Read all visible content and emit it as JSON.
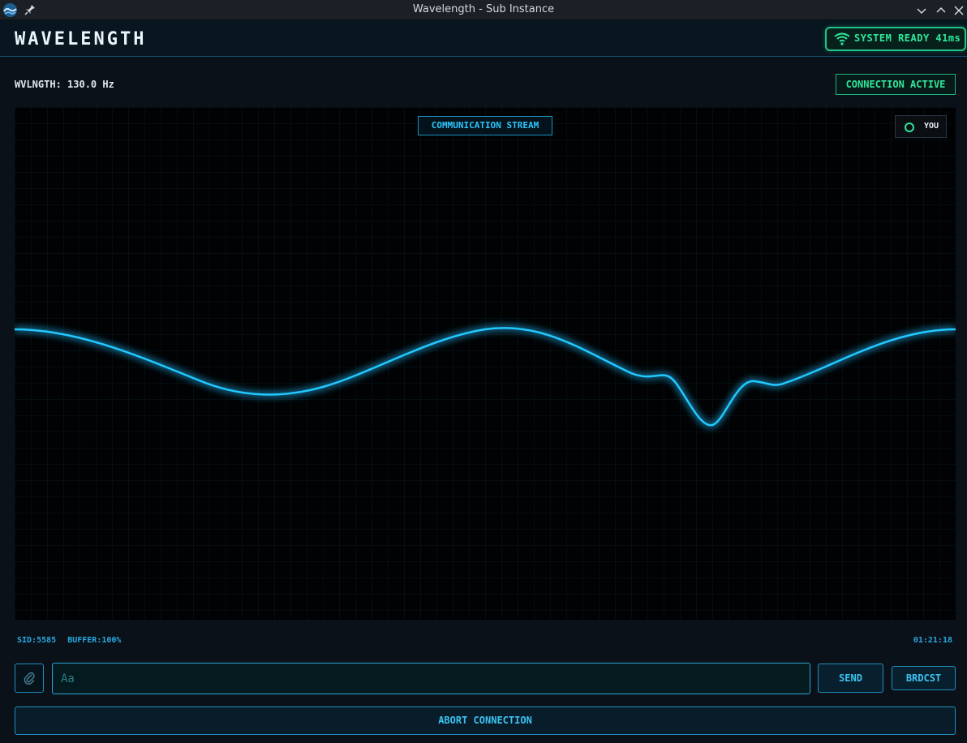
{
  "window": {
    "title": "Wavelength - Sub Instance",
    "icons": [
      "app-icon",
      "pin-icon",
      "minimize-icon",
      "maximize-icon",
      "close-icon"
    ]
  },
  "header": {
    "logo": "WAVELENGTH",
    "status": "SYSTEM READY 41ms",
    "status_icon": "wifi-icon"
  },
  "info": {
    "frequency": "WVLNGTH: 130.0 Hz",
    "connection": "CONNECTION ACTIVE"
  },
  "scope": {
    "label": "COMMUNICATION STREAM",
    "legend": "YOU",
    "wave_color": "#22c8ff",
    "legend_color": "#2be59a"
  },
  "footer": {
    "sid": "SID:5585",
    "buffer": "BUFFER:100%",
    "time": "01:21:18"
  },
  "input": {
    "attach_icon": "paperclip-icon",
    "placeholder": "Aa",
    "value": ""
  },
  "buttons": {
    "send": "SEND",
    "broadcast": "BRDCST",
    "abort": "ABORT CONNECTION"
  },
  "colors": {
    "accent": "#2cc7ff",
    "status_green": "#2ee89a",
    "background": "#0b1119"
  }
}
